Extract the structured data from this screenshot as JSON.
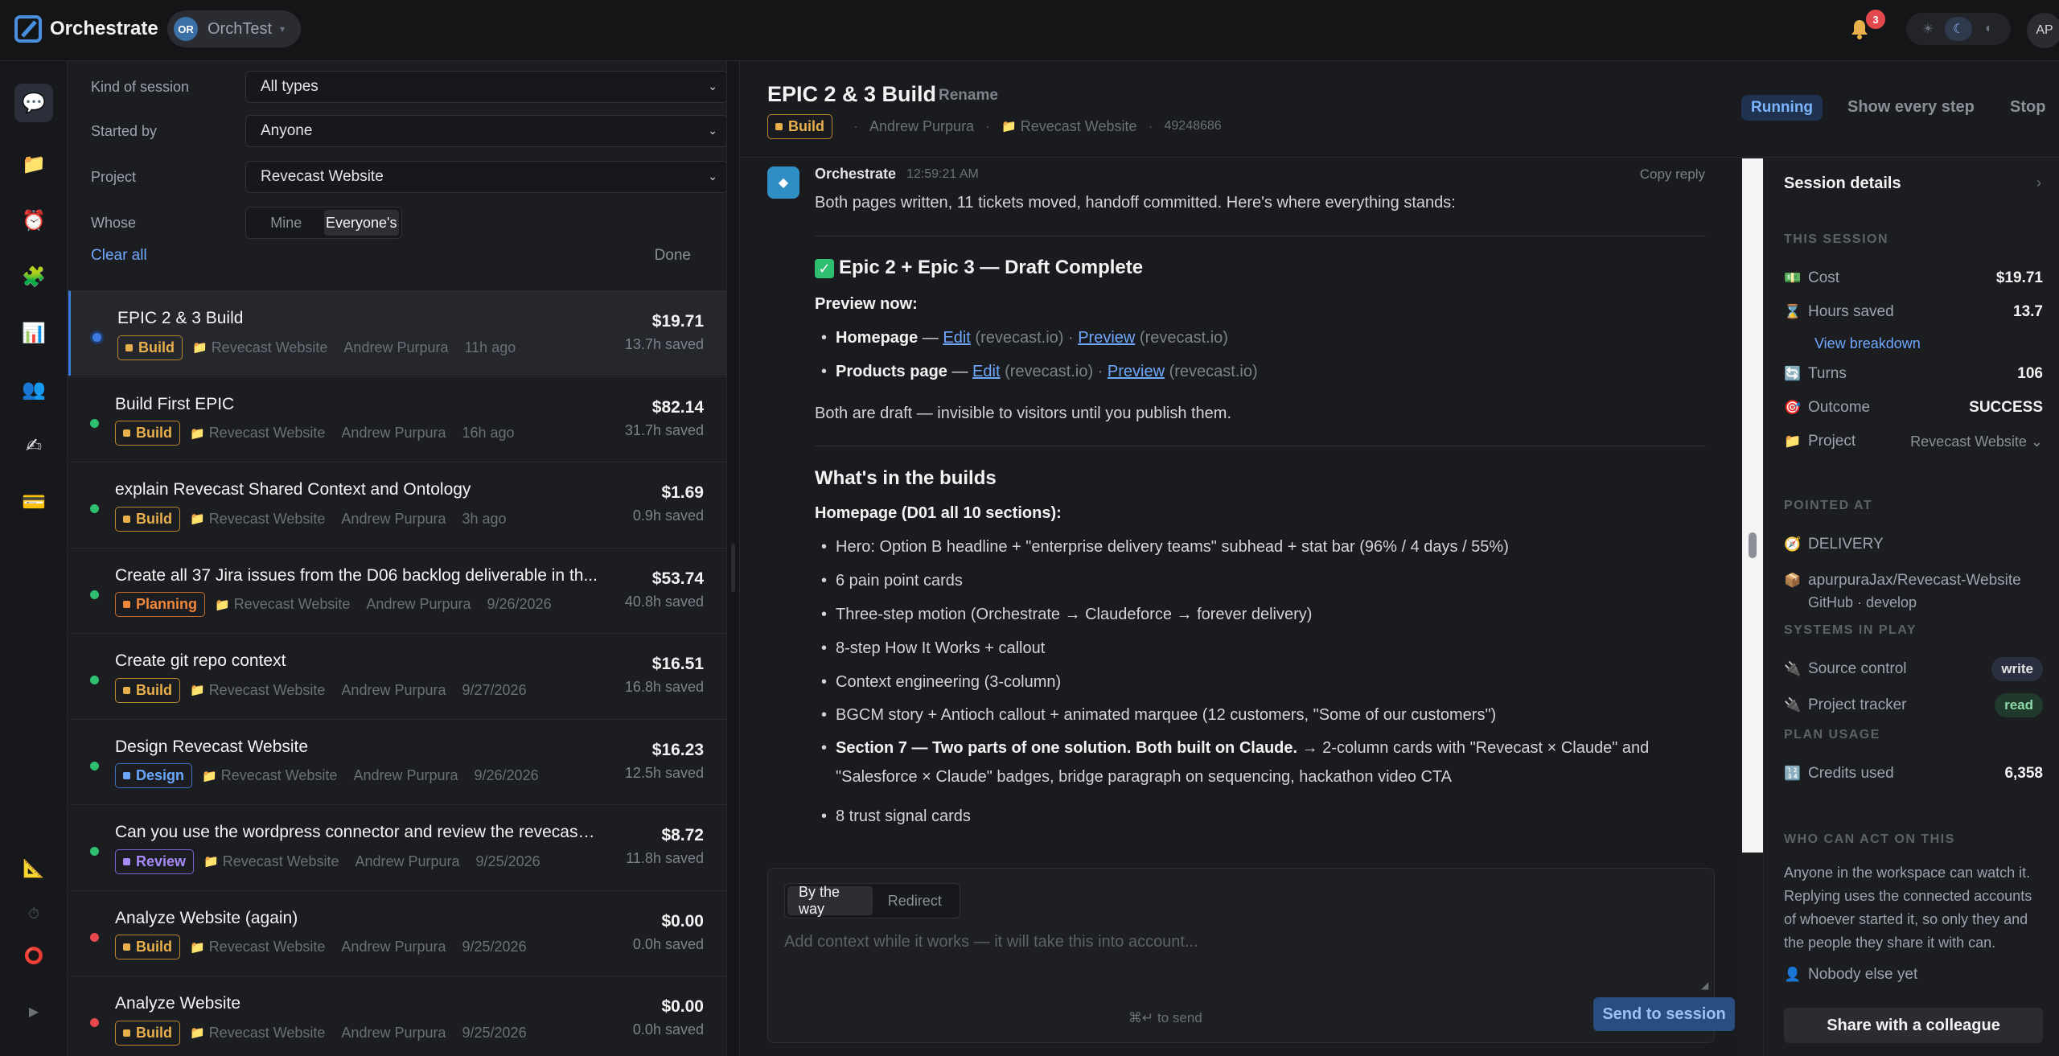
{
  "app": {
    "title": "Orchestrate",
    "workspace_initials": "OR",
    "workspace_name": "OrchTest",
    "notifications": "3",
    "user_initials": "AP"
  },
  "theme": {
    "light": "☀",
    "dark": "☾",
    "auto": "◐"
  },
  "filters": {
    "kind_label": "Kind of session",
    "kind_value": "All types",
    "started_label": "Started by",
    "started_value": "Anyone",
    "project_label": "Project",
    "project_value": "Revecast Website",
    "whose_label": "Whose",
    "whose_mine": "Mine",
    "whose_everyone": "Everyone's",
    "clear_all": "Clear all",
    "done": "Done"
  },
  "sessions": [
    {
      "title": "EPIC 2 & 3 Build",
      "tag": "Build",
      "project": "Revecast Website",
      "owner": "Andrew Purpura",
      "when": "11h ago",
      "cost": "$19.71",
      "saved": "13.7h saved",
      "status": "running"
    },
    {
      "title": "Build First EPIC",
      "tag": "Build",
      "project": "Revecast Website",
      "owner": "Andrew Purpura",
      "when": "16h ago",
      "cost": "$82.14",
      "saved": "31.7h saved",
      "status": "ok"
    },
    {
      "title": "explain Revecast Shared Context and Ontology",
      "tag": "Build",
      "project": "Revecast Website",
      "owner": "Andrew Purpura",
      "when": "3h ago",
      "cost": "$1.69",
      "saved": "0.9h saved",
      "status": "ok"
    },
    {
      "title": "Create all 37 Jira issues from the D06 backlog deliverable in th...",
      "tag": "Planning",
      "project": "Revecast Website",
      "owner": "Andrew Purpura",
      "when": "9/26/2026",
      "cost": "$53.74",
      "saved": "40.8h saved",
      "status": "ok"
    },
    {
      "title": "Create git repo context",
      "tag": "Build",
      "project": "Revecast Website",
      "owner": "Andrew Purpura",
      "when": "9/27/2026",
      "cost": "$16.51",
      "saved": "16.8h saved",
      "status": "ok"
    },
    {
      "title": "Design Revecast Website",
      "tag": "Design",
      "project": "Revecast Website",
      "owner": "Andrew Purpura",
      "when": "9/26/2026",
      "cost": "$16.23",
      "saved": "12.5h saved",
      "status": "ok"
    },
    {
      "title": "Can you use the wordpress connector and review the revecast.io...",
      "tag": "Review",
      "project": "Revecast Website",
      "owner": "Andrew Purpura",
      "when": "9/25/2026",
      "cost": "$8.72",
      "saved": "11.8h saved",
      "status": "ok"
    },
    {
      "title": "Analyze Website (again)",
      "tag": "Build",
      "project": "Revecast Website",
      "owner": "Andrew Purpura",
      "when": "9/25/2026",
      "cost": "$0.00",
      "saved": "0.0h saved",
      "status": "failed"
    },
    {
      "title": "Analyze Website",
      "tag": "Build",
      "project": "Revecast Website",
      "owner": "Andrew Purpura",
      "when": "9/25/2026",
      "cost": "$0.00",
      "saved": "0.0h saved",
      "status": "failed"
    }
  ],
  "colors": {
    "ok": "#2fbf71",
    "failed": "#e5484d",
    "running": "#3d7be0",
    "accent": "#6ea8fe"
  },
  "main": {
    "title": "EPIC 2 & 3 Build",
    "rename": "Rename",
    "tag": "Build",
    "owner": "Andrew Purpura",
    "project": "Revecast Website",
    "id": "49248686",
    "status": "Running",
    "show_steps": "Show every step",
    "stop": "Stop"
  },
  "message": {
    "author": "Orchestrate",
    "time": "12:59:21 AM",
    "copy": "Copy reply",
    "intro": "Both pages written, 11 tickets moved, handoff committed. Here's where everything stands:",
    "h1": "Epic 2 + Epic 3 — Draft Complete",
    "preview_now": "Preview now:",
    "home_label": "Homepage",
    "products_label": "Products page",
    "edit": "Edit",
    "preview": "Preview",
    "domain": "(revecast.io)",
    "dash": " — ",
    "dot": " · ",
    "draft_note": "Both are draft — invisible to visitors until you publish them.",
    "h2": "What's in the builds",
    "home_sections": "Homepage (D01 all 10 sections):",
    "b1": "Hero: Option B headline + \"enterprise delivery teams\" subhead + stat bar (96% / 4 days / 55%)",
    "b2": "6 pain point cards",
    "b3": "Three-step motion (Orchestrate → Claudeforce → forever delivery)",
    "b4": "8-step How It Works + callout",
    "b5": "Context engineering (3-column)",
    "b6": "BGCM story + Antioch callout + animated marquee (12 customers, \"Some of our customers\")",
    "b7_bold": "Section 7 — Two parts of one solution. Both built on Claude.",
    "b7_rest": " → 2-column cards with \"Revecast × Claude\" and \"Salesforce × Claude\" badges, bridge paragraph on sequencing, hackathon video CTA",
    "b8": "8 trust signal cards"
  },
  "composer": {
    "by_the_way": "By the way",
    "redirect": "Redirect",
    "placeholder": "Add context while it works — it will take this into account...",
    "hint": "⌘↵ to send",
    "send": "Send to session"
  },
  "details": {
    "title": "Session details",
    "this_session": "THIS SESSION",
    "cost_label": "Cost",
    "cost": "$19.71",
    "hours_label": "Hours saved",
    "hours": "13.7",
    "breakdown": "View breakdown",
    "turns_label": "Turns",
    "turns": "106",
    "outcome_label": "Outcome",
    "outcome": "SUCCESS",
    "project_label": "Project",
    "project": "Revecast Website",
    "pointed_at": "POINTED AT",
    "delivery": "DELIVERY",
    "repo": "apurpuraJax/Revecast-Website",
    "repo_sub": "GitHub · develop",
    "systems": "SYSTEMS IN PLAY",
    "source_control": "Source control",
    "source_perm": "write",
    "project_tracker": "Project tracker",
    "tracker_perm": "read",
    "plan_usage": "PLAN USAGE",
    "credits_label": "Credits used",
    "credits": "6,358",
    "who_can_act": "WHO CAN ACT ON THIS",
    "who_para": "Anyone in the workspace can watch it. Replying uses the connected accounts of whoever started it, so only they and the people they share it with can.",
    "nobody": "Nobody else yet",
    "share": "Share with a colleague"
  }
}
